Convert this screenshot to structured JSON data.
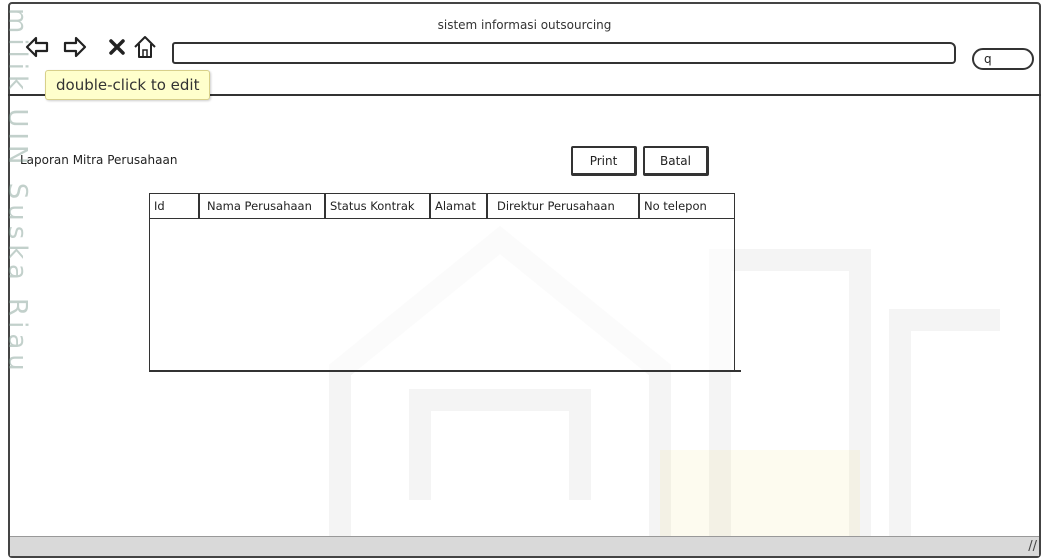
{
  "window": {
    "title": "sistem informasi outsourcing"
  },
  "toolbar": {
    "back_icon": "back-arrow-icon",
    "forward_icon": "forward-arrow-icon",
    "stop_icon": "close-icon",
    "home_icon": "home-icon",
    "address_value": "",
    "search_glyph": "q",
    "tooltip": "double-click to edit"
  },
  "watermark": {
    "vertical_text": "milik UIN Suska Riau",
    "logo": "uin-suska-riau-logo"
  },
  "page": {
    "title": "Laporan Mitra Perusahaan",
    "print_label": "Print",
    "batal_label": "Batal"
  },
  "table": {
    "columns": [
      "Id",
      "Nama Perusahaan",
      "Status Kontrak",
      "Alamat",
      "Direktur Perusahaan",
      "No telepon"
    ],
    "rows": []
  },
  "statusbar": {
    "grip_glyph": "//"
  },
  "colors": {
    "frame": "#444444",
    "tooltip_bg": "#ffffcc",
    "watermark": "#7896 8c"
  }
}
